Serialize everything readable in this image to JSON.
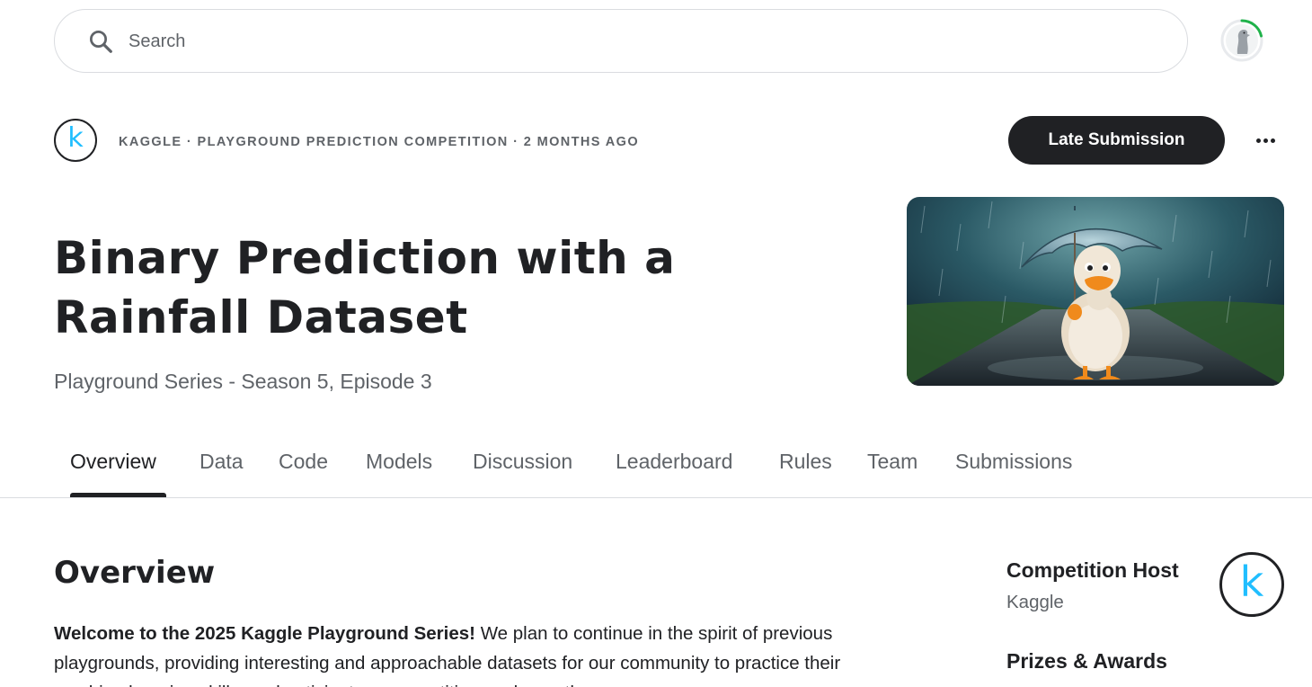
{
  "search": {
    "placeholder": "Search"
  },
  "header": {
    "logo_letter": "k",
    "meta": "KAGGLE · PLAYGROUND PREDICTION COMPETITION · 2 MONTHS AGO",
    "late_submission_label": "Late Submission",
    "more_icon": "more-horizontal-icon"
  },
  "competition": {
    "title": "Binary Prediction with a Rainfall Dataset",
    "subtitle": "Playground Series - Season 5, Episode 3"
  },
  "tabs": [
    {
      "label": "Overview",
      "active": true
    },
    {
      "label": "Data"
    },
    {
      "label": "Code"
    },
    {
      "label": "Models"
    },
    {
      "label": "Discussion"
    },
    {
      "label": "Leaderboard"
    },
    {
      "label": "Rules"
    },
    {
      "label": "Team"
    },
    {
      "label": "Submissions"
    }
  ],
  "overview": {
    "heading": "Overview",
    "lead_bold": "Welcome to the 2025 Kaggle Playground Series!",
    "lead_text": " We plan to continue in the spirit of previous playgrounds, providing interesting and approachable datasets for our community to practice their machine learning skills, and anticipate a competition each month."
  },
  "sidebar": {
    "host_label": "Competition Host",
    "host_name": "Kaggle",
    "host_logo_letter": "k",
    "prizes_label": "Prizes & Awards"
  },
  "colors": {
    "accent": "#20beff",
    "dark": "#202124",
    "muted": "#5f6368",
    "progress_ring": "#1fb24a"
  }
}
